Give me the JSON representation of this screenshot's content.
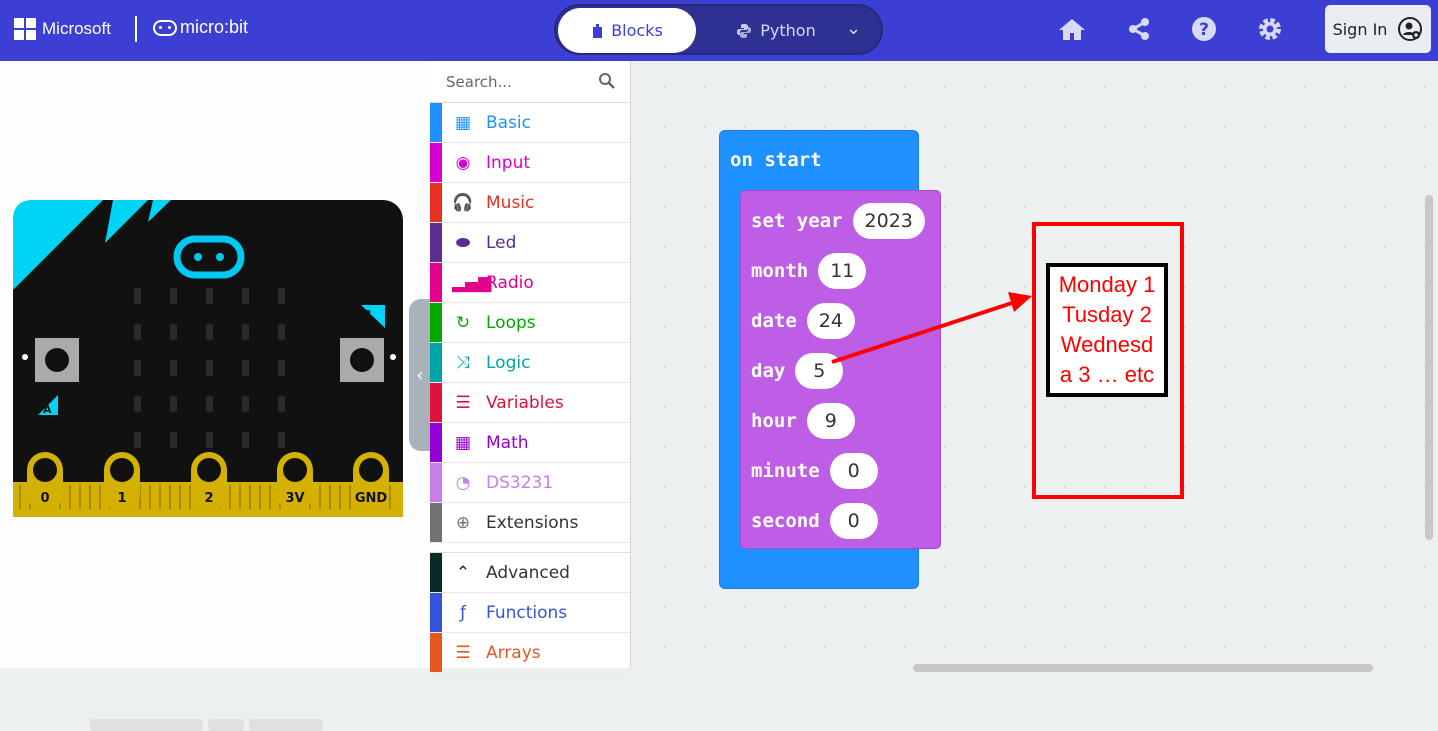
{
  "header": {
    "brand": "Microsoft",
    "product": "micro:bit",
    "tabs": [
      {
        "label": "Blocks",
        "icon": "puzzle-icon",
        "active": true
      },
      {
        "label": "Python",
        "icon": "python-icon",
        "active": false
      }
    ],
    "icons": [
      "home-icon",
      "share-icon",
      "help-icon",
      "settings-icon"
    ],
    "sign_in": "Sign In"
  },
  "simulator": {
    "pins": [
      "0",
      "1",
      "2",
      "3V",
      "GND"
    ],
    "buttons": [
      "A",
      "B"
    ]
  },
  "toolbox": {
    "search_placeholder": "Search...",
    "categories": [
      {
        "label": "Basic",
        "color": "#1e90ff",
        "icon": "grid-icon"
      },
      {
        "label": "Input",
        "color": "#d400d4",
        "icon": "circle-icon"
      },
      {
        "label": "Music",
        "color": "#e63022",
        "icon": "headphones-icon"
      },
      {
        "label": "Led",
        "color": "#5c2d91",
        "icon": "toggle-icon"
      },
      {
        "label": "Radio",
        "color": "#e3008c",
        "icon": "signal-icon"
      },
      {
        "label": "Loops",
        "color": "#00aa00",
        "icon": "refresh-icon"
      },
      {
        "label": "Logic",
        "color": "#00a4a6",
        "icon": "shuffle-icon"
      },
      {
        "label": "Variables",
        "color": "#dc143c",
        "icon": "list-icon"
      },
      {
        "label": "Math",
        "color": "#9400d3",
        "icon": "calculator-icon"
      },
      {
        "label": "DS3231",
        "color": "#c87ee8",
        "icon": "clock-icon"
      },
      {
        "label": "Extensions",
        "color": "#717171",
        "icon": "plus-icon"
      }
    ],
    "advanced": [
      {
        "label": "Advanced",
        "color": "#0a2a2a",
        "icon": "chevron-up-icon"
      },
      {
        "label": "Functions",
        "color": "#3455db",
        "icon": "function-icon"
      },
      {
        "label": "Arrays",
        "color": "#e65722",
        "icon": "array-icon"
      }
    ]
  },
  "workspace": {
    "event": "on start",
    "rows": [
      {
        "label": "set year",
        "value": "2023"
      },
      {
        "label": "month",
        "value": "11"
      },
      {
        "label": "date",
        "value": "24"
      },
      {
        "label": "day",
        "value": "5"
      },
      {
        "label": "hour",
        "value": "9"
      },
      {
        "label": "minute",
        "value": "0"
      },
      {
        "label": "second",
        "value": "0"
      }
    ],
    "annotation": [
      "Monday 1",
      "Tusday 2",
      "Wednesd",
      "a 3 … etc"
    ]
  }
}
